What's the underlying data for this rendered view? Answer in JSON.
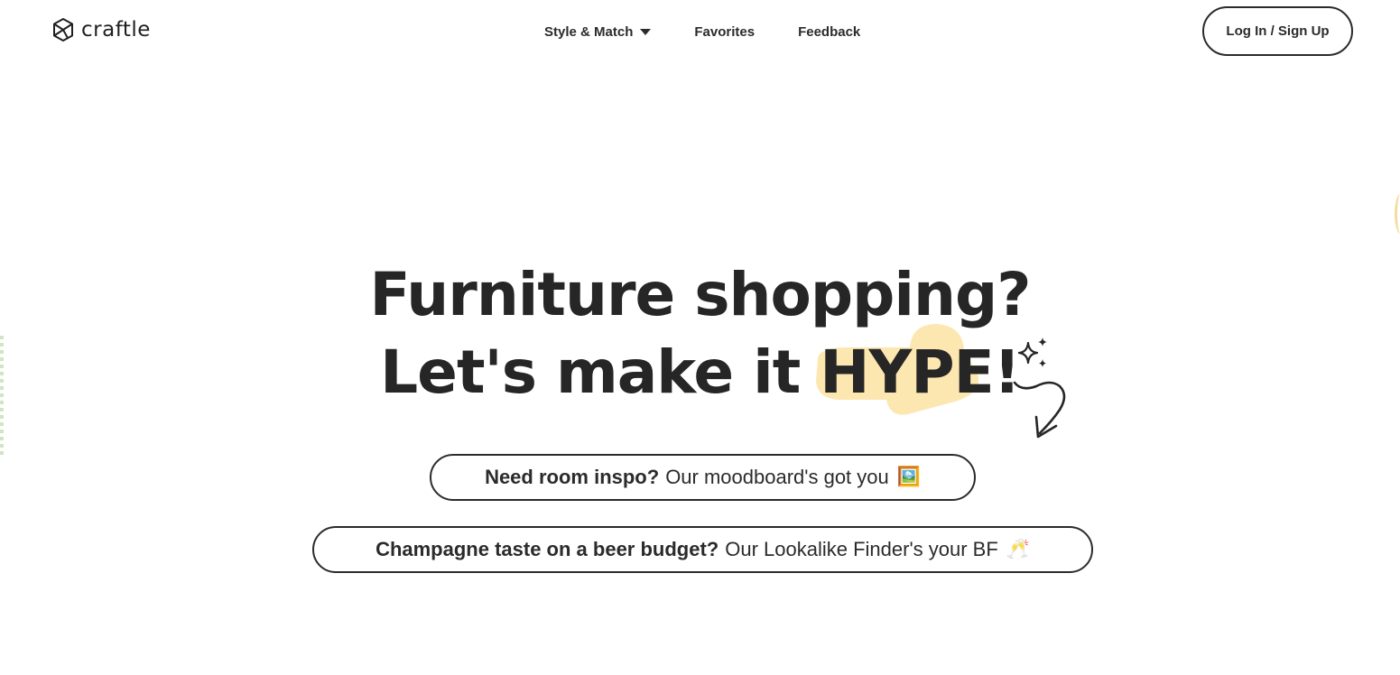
{
  "brand": {
    "name": "craftle",
    "logo_icon": "cube-logo-icon"
  },
  "nav": {
    "style_match": "Style & Match",
    "style_match_icon": "caret-down-icon",
    "favorites": "Favorites",
    "feedback": "Feedback"
  },
  "header": {
    "login_label": "Log In / Sign Up"
  },
  "hero": {
    "line1": "Furniture shopping?",
    "line2_prefix": "Let's make it ",
    "line2_highlight": "HYPE!",
    "highlight_color": "#fde7b0",
    "decorations": [
      "sparkles-icon",
      "curly-arrow-icon"
    ]
  },
  "ctas": {
    "moodboard": {
      "bold": "Need room inspo?",
      "text": "Our moodboard's got you",
      "emoji": "🖼️"
    },
    "lookalike": {
      "bold": "Champagne taste on a beer budget?",
      "text": "Our Lookalike Finder's your BF",
      "emoji": "🥂"
    }
  }
}
